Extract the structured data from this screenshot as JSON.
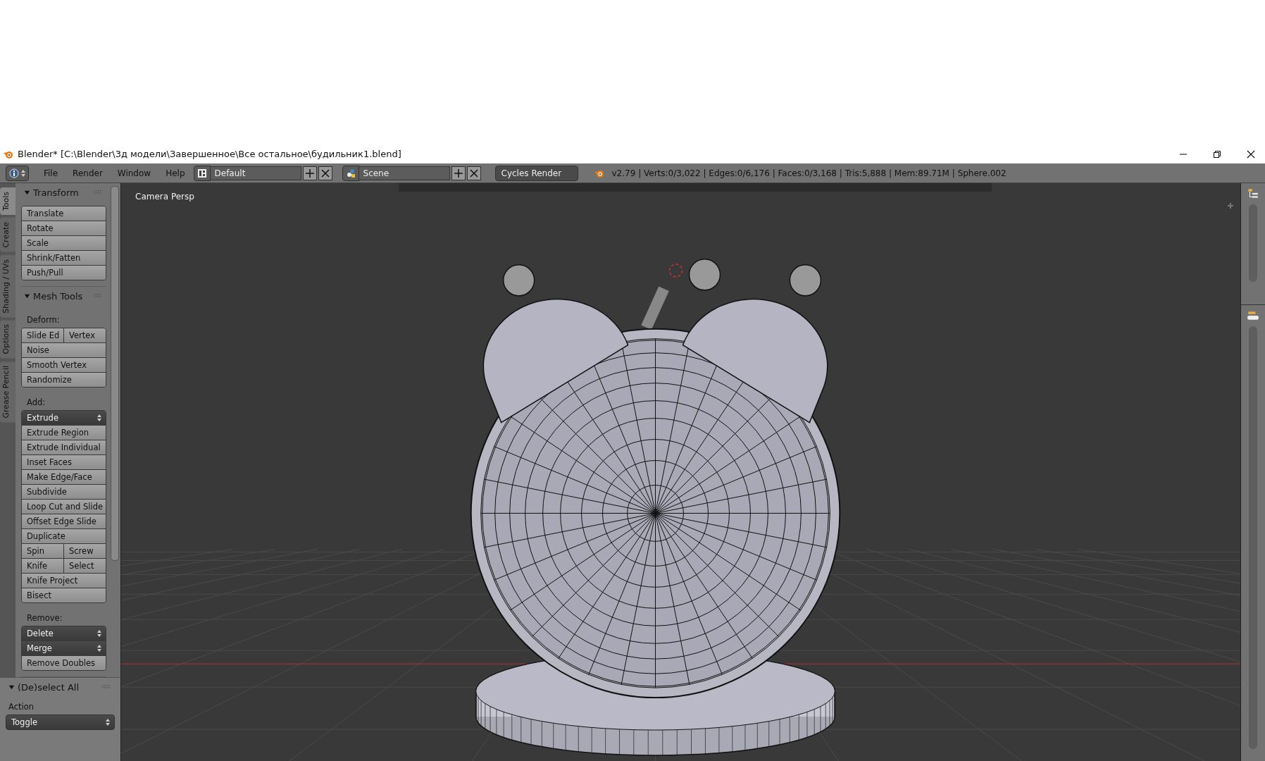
{
  "window": {
    "title": "Blender* [C:\\Blender\\3д модели\\Завершенное\\Все остальное\\будильник1.blend]"
  },
  "header": {
    "menus": [
      "File",
      "Render",
      "Window",
      "Help"
    ],
    "layout": "Default",
    "scene": "Scene",
    "engine": "Cycles Render",
    "stats": "v2.79 | Verts:0/3,022 | Edges:0/6,176 | Faces:0/3,168 | Tris:5,888 | Mem:89.71M | Sphere.002"
  },
  "tool_tabs": [
    {
      "label": "Tools",
      "selected": true
    },
    {
      "label": "Create",
      "selected": false
    },
    {
      "label": "Shading / UVs",
      "selected": false
    },
    {
      "label": "Options",
      "selected": false
    },
    {
      "label": "Grease Pencil",
      "selected": false
    }
  ],
  "tool_sections": [
    {
      "title": "Transform",
      "expanded": true,
      "items": [
        {
          "kind": "group",
          "rows": [
            [
              {
                "label": "Translate",
                "kind": "button"
              }
            ],
            [
              {
                "label": "Rotate",
                "kind": "button"
              }
            ],
            [
              {
                "label": "Scale",
                "kind": "button"
              }
            ],
            [
              {
                "label": "Shrink/Fatten",
                "kind": "button"
              }
            ],
            [
              {
                "label": "Push/Pull",
                "kind": "button"
              }
            ]
          ]
        }
      ]
    },
    {
      "title": "Mesh Tools",
      "expanded": true,
      "items": [
        {
          "kind": "label",
          "text": "Deform:"
        },
        {
          "kind": "group",
          "rows": [
            [
              {
                "label": "Slide Ed",
                "kind": "button"
              },
              {
                "label": "Vertex",
                "kind": "button"
              }
            ],
            [
              {
                "label": "Noise",
                "kind": "button"
              }
            ],
            [
              {
                "label": "Smooth Vertex",
                "kind": "button"
              }
            ],
            [
              {
                "label": "Randomize",
                "kind": "button"
              }
            ]
          ]
        },
        {
          "kind": "label",
          "text": "Add:"
        },
        {
          "kind": "group",
          "rows": [
            [
              {
                "label": "Extrude",
                "kind": "menu"
              }
            ],
            [
              {
                "label": "Extrude Region",
                "kind": "button"
              }
            ],
            [
              {
                "label": "Extrude Individual",
                "kind": "button"
              }
            ],
            [
              {
                "label": "Inset Faces",
                "kind": "button"
              }
            ],
            [
              {
                "label": "Make Edge/Face",
                "kind": "button"
              }
            ],
            [
              {
                "label": "Subdivide",
                "kind": "button"
              }
            ],
            [
              {
                "label": "Loop Cut and Slide",
                "kind": "button"
              }
            ],
            [
              {
                "label": "Offset Edge Slide",
                "kind": "button"
              }
            ],
            [
              {
                "label": "Duplicate",
                "kind": "button"
              }
            ],
            [
              {
                "label": "Spin",
                "kind": "button"
              },
              {
                "label": "Screw",
                "kind": "button"
              }
            ],
            [
              {
                "label": "Knife",
                "kind": "button"
              },
              {
                "label": "Select",
                "kind": "button"
              }
            ],
            [
              {
                "label": "Knife Project",
                "kind": "button"
              }
            ],
            [
              {
                "label": "Bisect",
                "kind": "button"
              }
            ]
          ]
        },
        {
          "kind": "label",
          "text": "Remove:"
        },
        {
          "kind": "group",
          "rows": [
            [
              {
                "label": "Delete",
                "kind": "menu"
              }
            ],
            [
              {
                "label": "Merge",
                "kind": "menu"
              }
            ],
            [
              {
                "label": "Remove Doubles",
                "kind": "button"
              }
            ]
          ]
        }
      ]
    }
  ],
  "operator_panel": {
    "title": "(De)select All",
    "expanded": true,
    "field_label": "Action",
    "value": "Toggle"
  },
  "viewport": {
    "view_label": "Camera Persp"
  }
}
